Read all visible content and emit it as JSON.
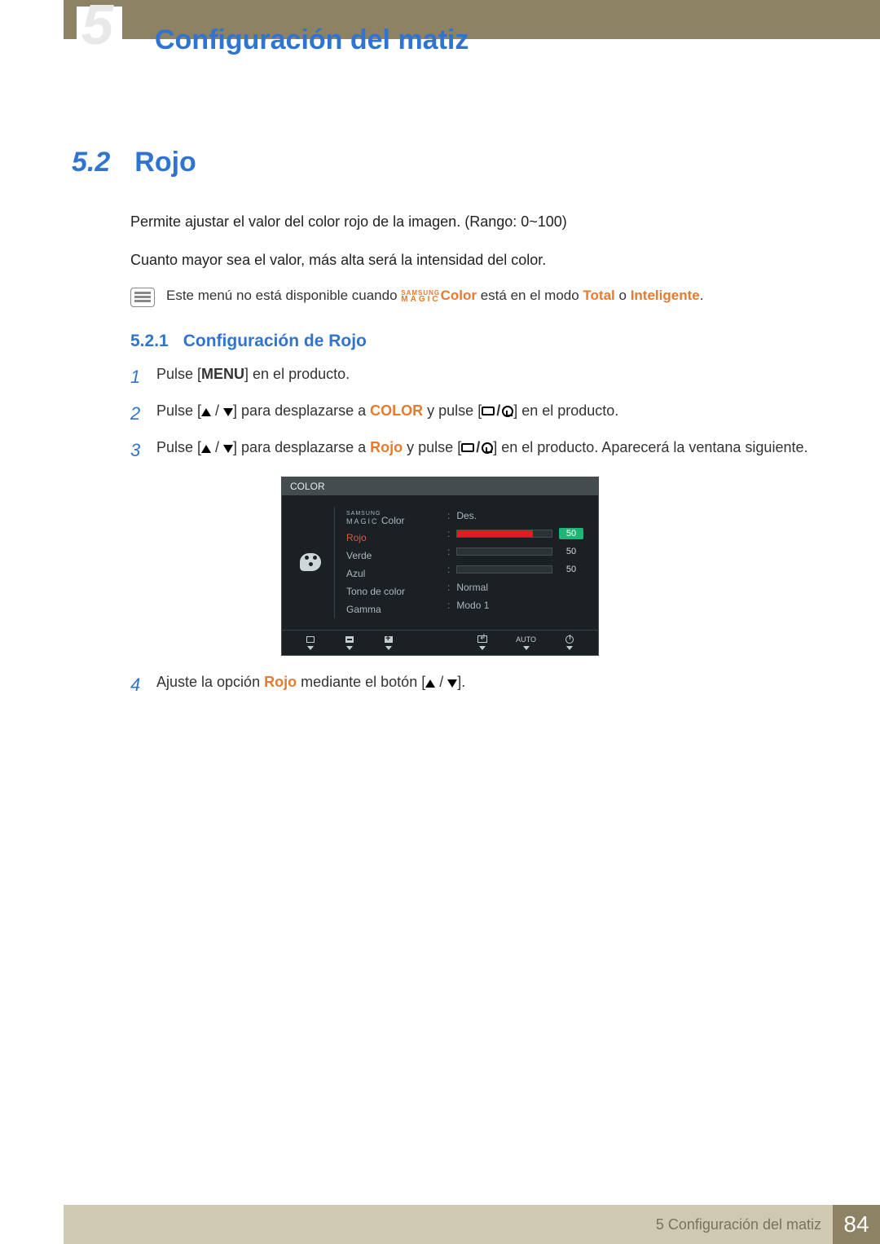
{
  "header": {
    "chapter_ghost": "5",
    "chapter_title": "Configuración del matiz"
  },
  "section": {
    "number": "5.2",
    "title": "Rojo",
    "para1": "Permite ajustar el valor del color rojo de la imagen. (Rango: 0~100)",
    "para2": "Cuanto mayor sea el valor, más alta será la intensidad del color."
  },
  "note": {
    "pre": "Este menú no está disponible cuando ",
    "brand_top": "SAMSUNG",
    "brand_bottom": "MAGIC",
    "brand_suffix": "Color",
    "mid": " está en el modo ",
    "mode1": "Total",
    "or": " o ",
    "mode2": "Inteligente",
    "end": "."
  },
  "subsection": {
    "number": "5.2.1",
    "title": "Configuración de Rojo"
  },
  "steps": {
    "s1": {
      "n": "1",
      "a": "Pulse [",
      "menu": "MENU",
      "b": "] en el producto."
    },
    "s2": {
      "n": "2",
      "a": "Pulse [",
      "b": "] para desplazarse a ",
      "target": "COLOR",
      "c": " y pulse [",
      "d": "] en el producto."
    },
    "s3": {
      "n": "3",
      "a": "Pulse [",
      "b": "] para desplazarse a ",
      "target": "Rojo",
      "c": " y pulse [",
      "d": "] en el producto. Aparecerá la ventana siguiente."
    },
    "s4": {
      "n": "4",
      "a": "Ajuste la opción ",
      "target": "Rojo",
      "b": " mediante el botón [",
      "c": "]."
    }
  },
  "osd": {
    "title": "COLOR",
    "magic_top": "SAMSUNG",
    "magic_bottom": "MAGIC",
    "magic_suffix": " Color",
    "rows": {
      "magic_value": "Des.",
      "rojo": {
        "label": "Rojo",
        "value": "50",
        "fill_pct": 80
      },
      "verde": {
        "label": "Verde",
        "value": "50"
      },
      "azul": {
        "label": "Azul",
        "value": "50"
      },
      "tono": {
        "label": "Tono de color",
        "value": "Normal"
      },
      "gamma": {
        "label": "Gamma",
        "value": "Modo 1"
      }
    },
    "footer_auto": "AUTO"
  },
  "footer": {
    "text": "5 Configuración del matiz",
    "page": "84"
  }
}
